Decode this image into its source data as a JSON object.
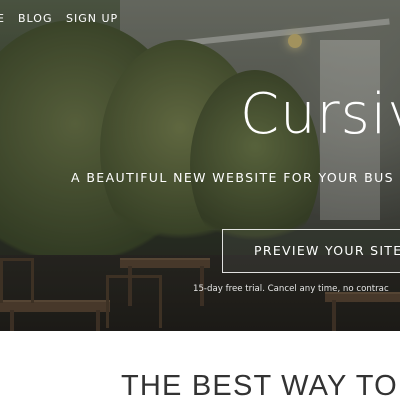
{
  "nav": {
    "partial_item": "E",
    "items": [
      "BLOG",
      "SIGN UP"
    ]
  },
  "hero": {
    "title": "Cursiv",
    "tagline": "A BEAUTIFUL NEW WEBSITE FOR YOUR BUS",
    "cta_label": "PREVIEW YOUR SITE N",
    "trial_note": "15-day free trial. Cancel any time, no contrac"
  },
  "section": {
    "title": "THE BEST WAY TO"
  },
  "colors": {
    "text_on_hero": "#ffffff",
    "section_text": "#333333",
    "page_background": "#ffffff"
  }
}
